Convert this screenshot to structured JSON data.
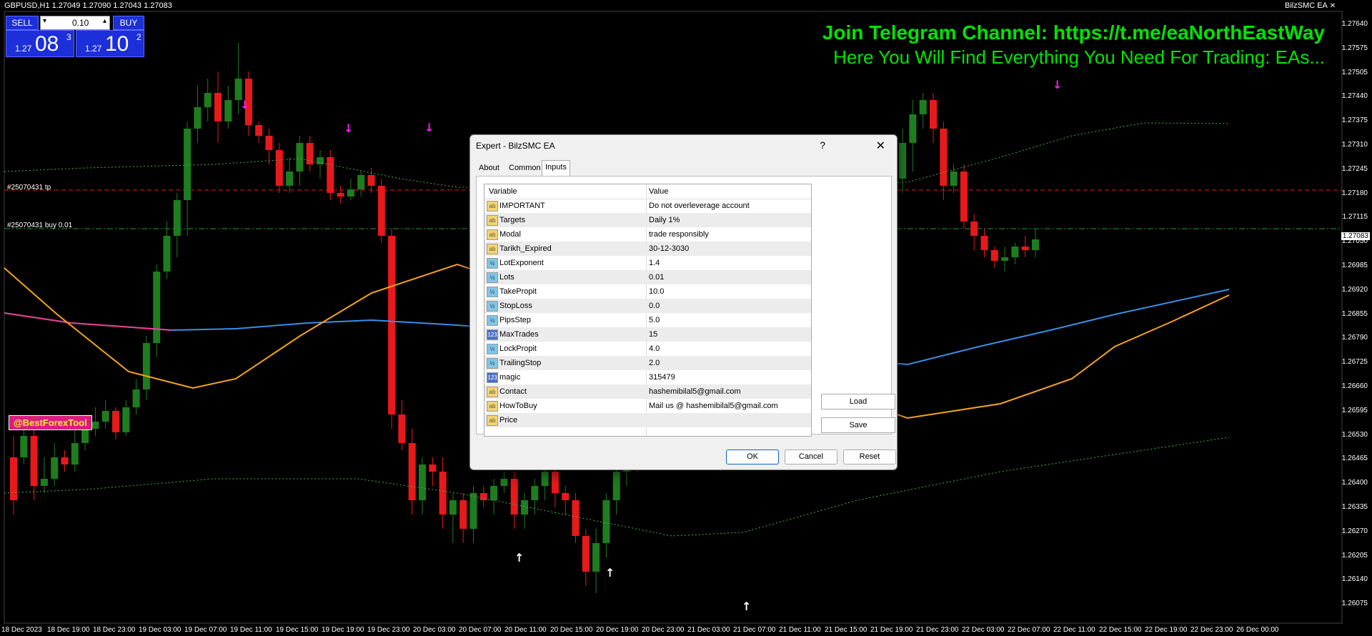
{
  "header": {
    "symbol_info": "GBPUSD,H1  1.27049 1.27090 1.27043 1.27083",
    "ea_name": "BilzSMC EA"
  },
  "telegram": {
    "line1": "Join Telegram Channel: https://t.me/eaNorthEastWay",
    "line2": "Here You Will Find Everything You Need For Trading: EAs..."
  },
  "trade_panel": {
    "sell_label": "SELL",
    "buy_label": "BUY",
    "lot_value": "0.10",
    "sell_prefix": "1.27",
    "sell_big": "08",
    "sell_sup": "3",
    "buy_prefix": "1.27",
    "buy_big": "10",
    "buy_sup": "2"
  },
  "watermark": "@BestForexTool",
  "trade_lines": {
    "tp_label": "#25070431 tp",
    "buy_label": "#25070431 buy 0.01"
  },
  "price_axis": [
    "1.27640",
    "1.27575",
    "1.27505",
    "1.27440",
    "1.27375",
    "1.27310",
    "1.27245",
    "1.27180",
    "1.27115",
    "1.27050",
    "1.26985",
    "1.26920",
    "1.26855",
    "1.26790",
    "1.26725",
    "1.26660",
    "1.26595",
    "1.26530",
    "1.26465",
    "1.26400",
    "1.26335",
    "1.26270",
    "1.26205",
    "1.26140",
    "1.26075"
  ],
  "current_price": "1.27083",
  "time_axis": [
    "18 Dec 2023",
    "18 Dec 19:00",
    "18 Dec 23:00",
    "19 Dec 03:00",
    "19 Dec 07:00",
    "19 Dec 11:00",
    "19 Dec 15:00",
    "19 Dec 19:00",
    "19 Dec 23:00",
    "20 Dec 03:00",
    "20 Dec 07:00",
    "20 Dec 11:00",
    "20 Dec 15:00",
    "20 Dec 19:00",
    "20 Dec 23:00",
    "21 Dec 03:00",
    "21 Dec 07:00",
    "21 Dec 11:00",
    "21 Dec 15:00",
    "21 Dec 19:00",
    "21 Dec 23:00",
    "22 Dec 03:00",
    "22 Dec 07:00",
    "22 Dec 11:00",
    "22 Dec 15:00",
    "22 Dec 19:00",
    "22 Dec 23:00",
    "26 Dec 00:00"
  ],
  "dialog": {
    "title": "Expert - BilzSMC EA",
    "help": "?",
    "close": "✕",
    "tabs": [
      "About",
      "Common",
      "Inputs"
    ],
    "col_variable": "Variable",
    "col_value": "Value",
    "rows": [
      {
        "icon": "ab",
        "label": "ab",
        "variable": "IMPORTANT",
        "value": "Do not overleverage account"
      },
      {
        "icon": "ab",
        "label": "ab",
        "variable": "Targets",
        "value": "Daily 1%"
      },
      {
        "icon": "ab",
        "label": "ab",
        "variable": "Modal",
        "value": "trade responsibly"
      },
      {
        "icon": "ab",
        "label": "ab",
        "variable": "Tarikh_Expired",
        "value": "30-12-3030"
      },
      {
        "icon": "v2",
        "label": "½",
        "variable": "LotExponent",
        "value": "1.4"
      },
      {
        "icon": "v2",
        "label": "½",
        "variable": "Lots",
        "value": "0.01"
      },
      {
        "icon": "v2",
        "label": "½",
        "variable": "TakePropit",
        "value": "10.0"
      },
      {
        "icon": "v2",
        "label": "½",
        "variable": "StopLoss",
        "value": "0.0"
      },
      {
        "icon": "v2",
        "label": "½",
        "variable": "PipsStep",
        "value": "5.0"
      },
      {
        "icon": "i123",
        "label": "123",
        "variable": "MaxTrades",
        "value": "15"
      },
      {
        "icon": "v2",
        "label": "½",
        "variable": "LockPropit",
        "value": "4.0"
      },
      {
        "icon": "v2",
        "label": "½",
        "variable": "TrailingStop",
        "value": "2.0"
      },
      {
        "icon": "i123",
        "label": "123",
        "variable": "magic",
        "value": "315479"
      },
      {
        "icon": "ab",
        "label": "ab",
        "variable": "Contact",
        "value": "hashemibilal5@gmail.com"
      },
      {
        "icon": "ab",
        "label": "ab",
        "variable": "HowToBuy",
        "value": "Mail us @ hashemibilal5@gmail.com"
      },
      {
        "icon": "ab",
        "label": "ab",
        "variable": "Price",
        "value": ""
      }
    ],
    "load_label": "Load",
    "save_label": "Save",
    "ok_label": "OK",
    "cancel_label": "Cancel",
    "reset_label": "Reset"
  },
  "colors": {
    "bull": "#1e7d1e",
    "bear": "#e8191a",
    "blue_ma": "#3a8ee6",
    "orange_ma": "#f5a31a",
    "pink_ma": "#e83e8c",
    "band": "#4caf50",
    "arrow_down": "#ff1aff",
    "arrow_up": "#ffffff"
  }
}
